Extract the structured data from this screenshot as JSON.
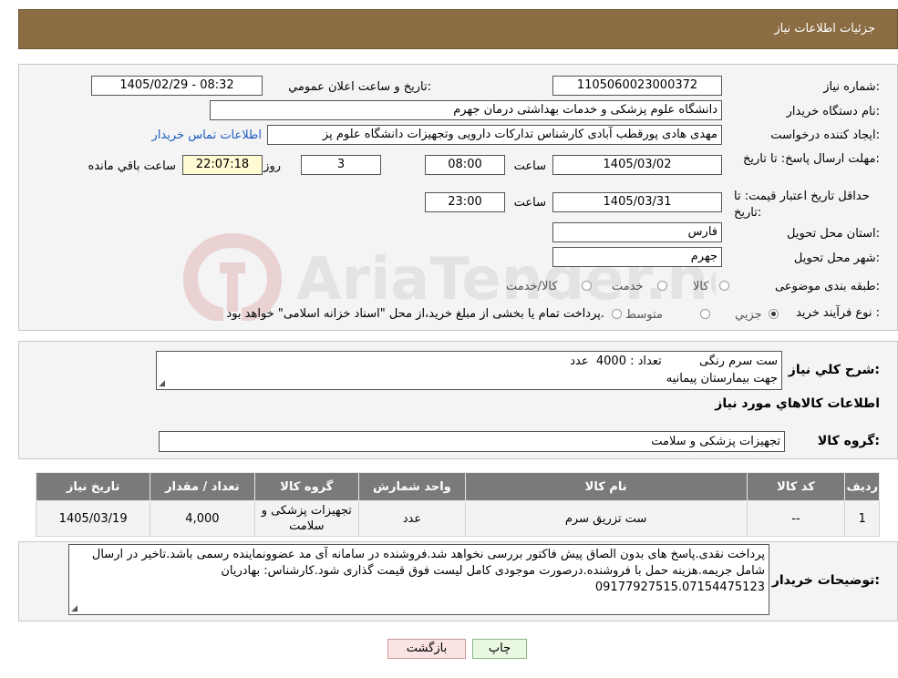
{
  "header": {
    "title": "جزئیات اطلاعات نیاز"
  },
  "form": {
    "need_number_label": "شماره نیاز:",
    "need_number": "1105060023000372",
    "announce_label": "تاریخ و ساعت اعلان عمومي:",
    "announce_value": "1405/02/29 - 08:32",
    "buyer_org_label": "نام دستگاه خریدار:",
    "buyer_org": "دانشگاه علوم پزشکی و خدمات بهداشتی  درمان جهرم",
    "creator_label": "ایجاد کننده درخواست:",
    "creator": "مهدی هادی پورقطب آبادی کارشناس تداركات دارویی وتجهیزات دانشگاه علوم پز",
    "contact_link": "اطلاعات تماس خریدار",
    "deadline_label": "مهلت ارسال پاسخ: تا تاریخ:",
    "deadline_date": "1405/03/02",
    "time_label": "ساعت",
    "deadline_time": "08:00",
    "days_value": "3",
    "days_label": "روز و",
    "remaining_time": "22:07:18",
    "remaining_label": "ساعت باقي مانده",
    "validity_label": "حداقل تاریخ اعتبار قیمت: تا تاریخ:",
    "validity_date": "1405/03/31",
    "validity_time": "23:00",
    "province_label": "استان محل تحویل:",
    "province": "فارس",
    "city_label": "شهر محل تحویل:",
    "city": "جهرم",
    "category_label": "طبقه بندی موضوعی:",
    "category_options": [
      "کالا",
      "خدمت",
      "کالا/خدمت"
    ],
    "process_label": "نوع فرآیند خرید :",
    "process_options": [
      "جزيي",
      "متوسط"
    ],
    "process_note": "پرداخت تمام یا بخشی از مبلغ خرید،از محل \"اسناد خزانه اسلامی\" خواهد بود."
  },
  "summary": {
    "label": "شرح کلي نياز:",
    "line1": "ست سرم رنگی          تعداد : 4000  عدد",
    "line2": "جهت بیمارستان پیمانیه",
    "goods_info_title": "اطلاعات کالاهاي مورد نياز",
    "group_label": "گروه کالا:",
    "group_value": "تجهیزات پزشکی و سلامت"
  },
  "table": {
    "headers": [
      "رديف",
      "کد کالا",
      "نام کالا",
      "واحد شمارش",
      "گروه کالا",
      "تعداد / مقدار",
      "تاريخ نياز"
    ],
    "rows": [
      [
        "1",
        "--",
        "ست تزریق سرم",
        "عدد",
        "تجهیزات پزشکی و سلامت",
        "4,000",
        "1405/03/19"
      ]
    ]
  },
  "buyer_notes": {
    "label": "توضيحات خريدار:",
    "text": "پرداخت نقدی.پاسخ های بدون الصاق پیش فاکتور بررسی نخواهد شد.فروشنده در سامانه آی مد عضوونماینده رسمی باشد.تاخیر در ارسال شامل جریمه.هزینه حمل با فروشنده.درصورت موجودی کامل لیست فوق قیمت گذاری شود.کارشناس: بهادریان 09177927515.07154475123"
  },
  "buttons": {
    "print": "چاپ",
    "back": "بازگشت"
  },
  "watermark": {
    "text": "AriaTender.neT"
  },
  "colors": {
    "header_bg": "#8b6c43",
    "link": "#1c5cc2",
    "table_header": "#7a7a7a"
  }
}
